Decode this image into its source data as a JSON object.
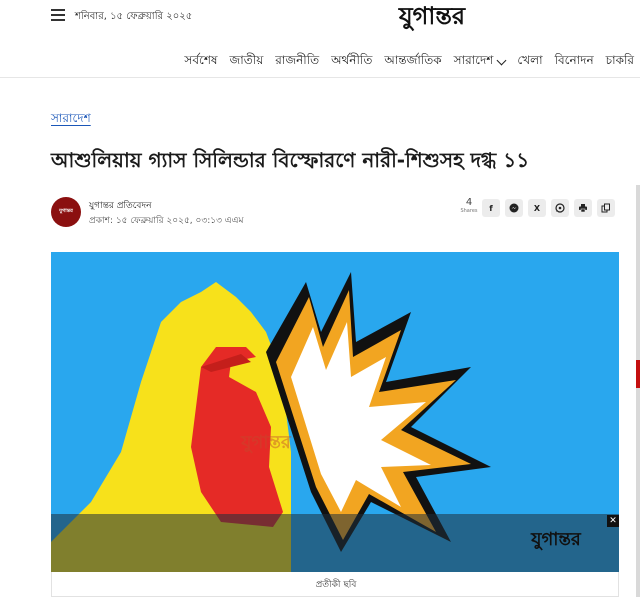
{
  "header": {
    "date": "শনিবার, ১৫ ফেব্রুয়ারি ২০২৫",
    "logo_text": "যুগান্তর",
    "nav": [
      {
        "label": "সর্বশেষ"
      },
      {
        "label": "জাতীয়"
      },
      {
        "label": "রাজনীতি"
      },
      {
        "label": "অর্থনীতি"
      },
      {
        "label": "আন্তর্জাতিক"
      },
      {
        "label": "সারাদেশ",
        "has_dropdown": true
      },
      {
        "label": "খেলা"
      },
      {
        "label": "বিনোদন"
      },
      {
        "label": "চাকরি"
      }
    ]
  },
  "article": {
    "category": "সারাদেশ",
    "headline": "আশুলিয়ায় গ্যাস সিলিন্ডার বিস্ফোরণে নারী-শিশুসহ দগ্ধ ১১",
    "author": "যুগান্তর প্রতিবেদন",
    "published": "প্রকাশ: ১৫ ফেব্রুয়ারি ২০২৫, ০৩:১৩ এএম",
    "avatar_text": "যুগান্তর",
    "shares_count": "4",
    "shares_label": "Shares",
    "share_buttons": [
      {
        "icon": "facebook-icon",
        "glyph": "f"
      },
      {
        "icon": "messenger-icon",
        "glyph": ""
      },
      {
        "icon": "x-twitter-icon",
        "glyph": "X"
      },
      {
        "icon": "whatsapp-icon",
        "glyph": ""
      },
      {
        "icon": "print-icon",
        "glyph": ""
      },
      {
        "icon": "copy-link-icon",
        "glyph": ""
      }
    ],
    "image": {
      "watermark_center": "যুগান্তর",
      "watermark_corner": "যুগান্তর",
      "close_glyph": "✕"
    },
    "caption": "প্রতীকী ছবি"
  },
  "colors": {
    "link_blue": "#1a56b8",
    "sky_blue": "#29a7ee",
    "yellow": "#f7e11b",
    "red": "#e52a26",
    "orange": "#f2a521",
    "black": "#111111"
  }
}
